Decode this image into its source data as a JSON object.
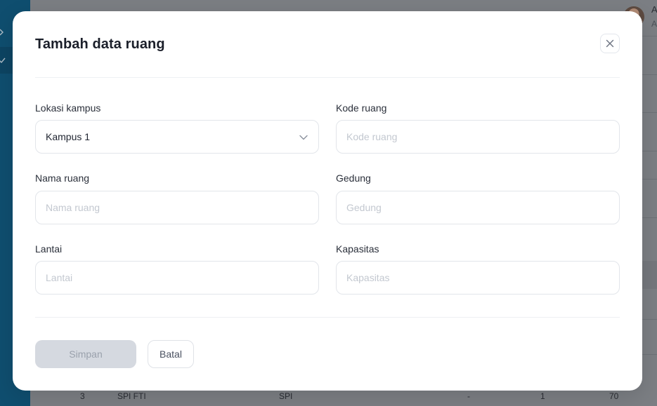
{
  "background": {
    "user_initial": "A",
    "user_sub": "A",
    "dots": "• •",
    "table_row": {
      "no": "3",
      "name": "SPI FTI",
      "code": "SPI",
      "dash": "-",
      "floor": "1",
      "capacity": "70"
    }
  },
  "modal": {
    "title": "Tambah data ruang",
    "fields": {
      "lokasi": {
        "label": "Lokasi kampus",
        "value": "Kampus 1"
      },
      "kode": {
        "label": "Kode ruang",
        "placeholder": "Kode ruang"
      },
      "nama": {
        "label": "Nama ruang",
        "placeholder": "Nama ruang"
      },
      "gedung": {
        "label": "Gedung",
        "placeholder": "Gedung"
      },
      "lantai": {
        "label": "Lantai",
        "placeholder": "Lantai"
      },
      "kapasitas": {
        "label": "Kapasitas",
        "placeholder": "Kapasitas"
      }
    },
    "buttons": {
      "save": "Simpan",
      "cancel": "Batal"
    }
  },
  "icons": {
    "close": "close-icon",
    "chevron": "chevron-down-icon",
    "sidebar_expand": "chevron-right-icon",
    "sidebar_check": "check-icon"
  },
  "colors": {
    "sidebar": "#0f4e6f",
    "overlay": "#7b7e83",
    "modal_bg": "#ffffff",
    "save_disabled": "#d5d9e0"
  }
}
